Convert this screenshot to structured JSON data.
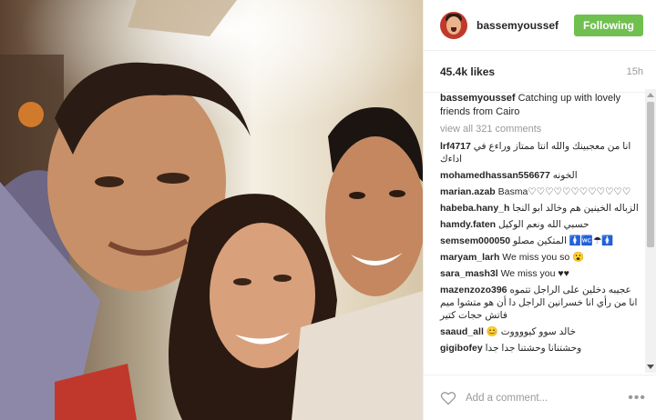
{
  "post": {
    "username": "bassemyoussef",
    "follow_label": "Following",
    "likes": "45.4k likes",
    "time": "15h",
    "caption_user": "bassemyoussef",
    "caption_text": "Catching up with lovely friends from Cairo",
    "view_all": "view all 321 comments"
  },
  "comments": [
    {
      "user": "lrf4717",
      "text": "انا من معجبينك والله انتا ممتاز وراءع في اداءك",
      "rtl": true
    },
    {
      "user": "mohamedhassan556677",
      "text": "الخونه",
      "rtl": true
    },
    {
      "user": "marian.azab",
      "text": "Basma♡♡♡♡♡♡♡♡♡♡♡♡",
      "rtl": false
    },
    {
      "user": "habeba.hany_h",
      "text": "الزباله الخينين هم وخالد ابو النجا",
      "rtl": true
    },
    {
      "user": "hamdy.faten",
      "text": "حسبي الله ونعم الوكيل",
      "rtl": true
    },
    {
      "user": "semsem000050",
      "text": "المتكين مصلو 🚺🚾☂🚺",
      "rtl": true
    },
    {
      "user": "maryam_larh",
      "text": "We miss you so 😮",
      "rtl": false
    },
    {
      "user": "sara_mash3l",
      "text": "We miss you ♥♥",
      "rtl": false
    },
    {
      "user": "mazenzozo396",
      "text": "عجيبه دخلين على الراجل تتموه انا من رأي انا خسرانين الراجل دا أن هو متشوا ميم فاتش حجات كتير",
      "rtl": true
    },
    {
      "user": "saaud_all",
      "text": "😊 خالد سوو كيووووت",
      "rtl": false
    },
    {
      "user": "gigibofey",
      "text": "وحشتنانا وحشتنا جدا جدا",
      "rtl": false
    }
  ],
  "footer": {
    "placeholder": "Add a comment...",
    "more": "•••"
  },
  "icons": {
    "heart": "heart-icon",
    "more": "more-options-icon"
  }
}
